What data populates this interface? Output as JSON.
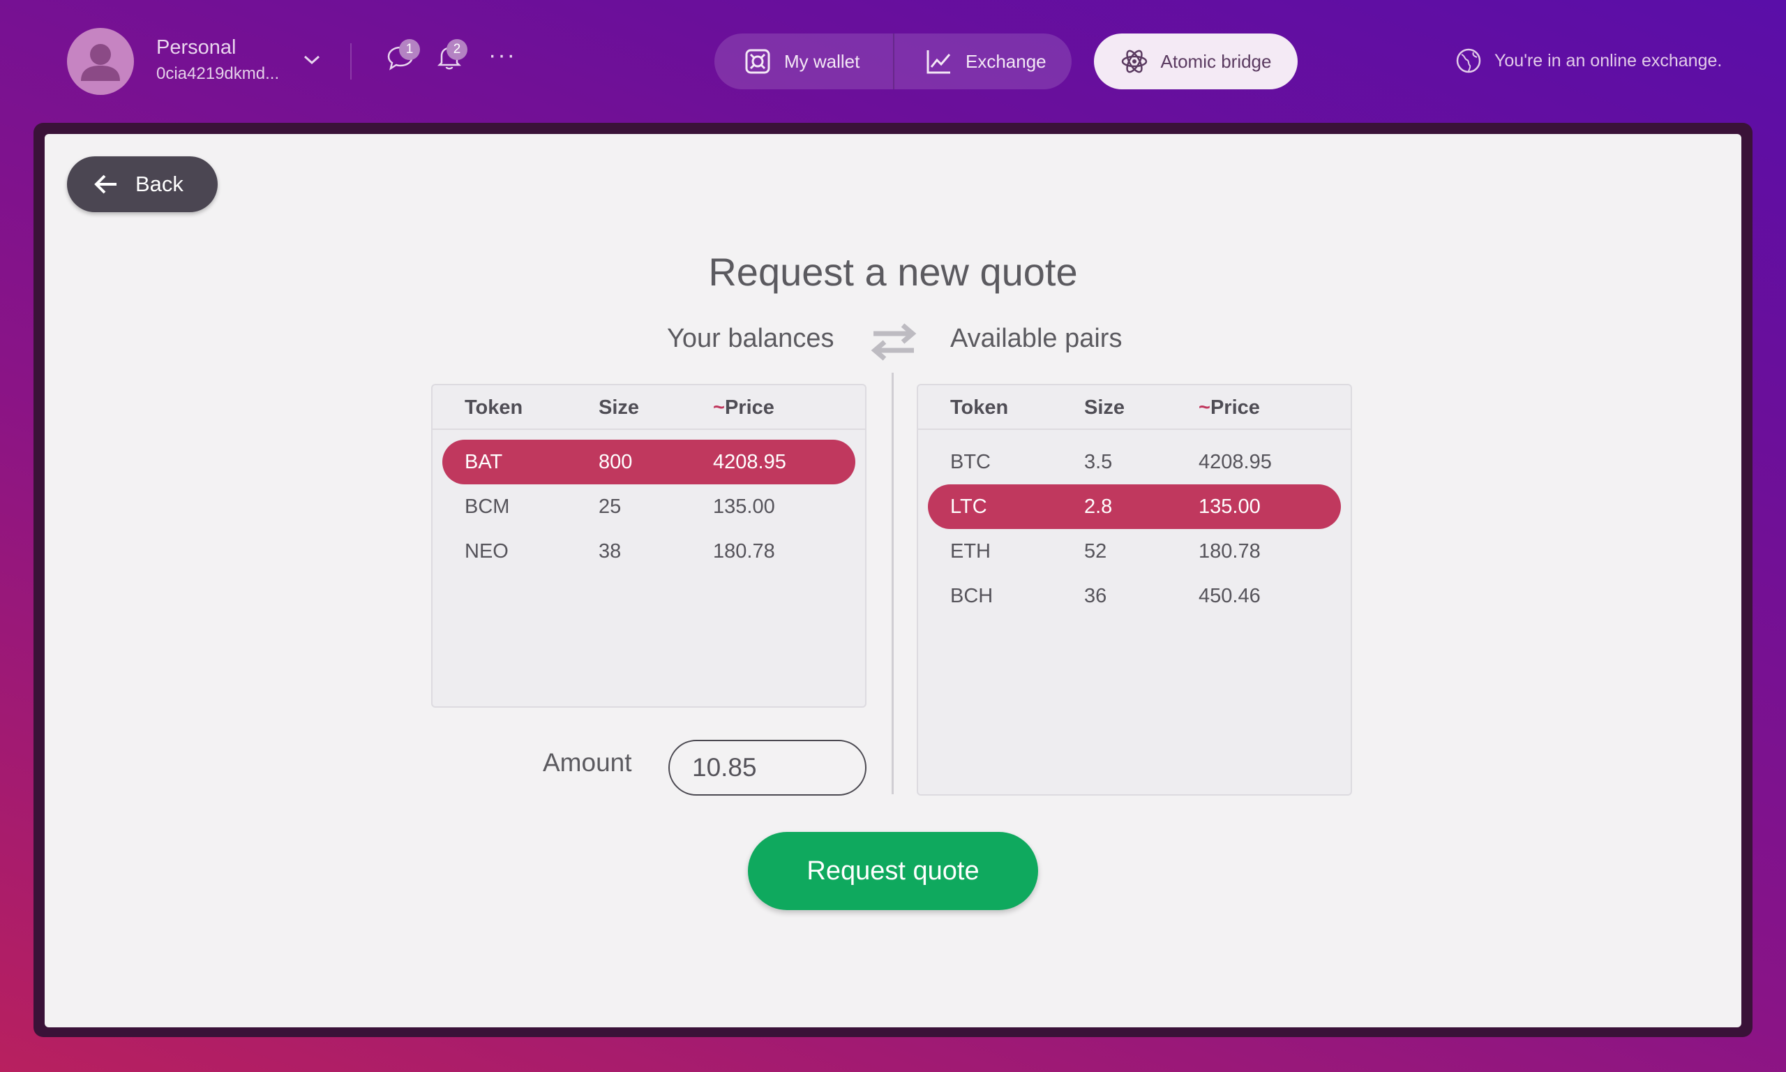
{
  "account": {
    "name": "Personal",
    "id": "0cia4219dkmd..."
  },
  "notifications": {
    "messages_count": "1",
    "alerts_count": "2"
  },
  "nav": {
    "wallet_label": "My wallet",
    "exchange_label": "Exchange",
    "bridge_label": "Atomic bridge"
  },
  "status_note": "You're in an online exchange.",
  "back_label": "Back",
  "title": "Request a new quote",
  "balances": {
    "heading": "Your balances",
    "columns": {
      "token": "Token",
      "size": "Size",
      "price_tilde": "~",
      "price": "Price"
    },
    "rows": [
      {
        "token": "BAT",
        "size": "800",
        "price": "4208.95",
        "selected": true
      },
      {
        "token": "BCM",
        "size": "25",
        "price": "135.00",
        "selected": false
      },
      {
        "token": "NEO",
        "size": "38",
        "price": "180.78",
        "selected": false
      }
    ]
  },
  "pairs": {
    "heading": "Available pairs",
    "columns": {
      "token": "Token",
      "size": "Size",
      "price_tilde": "~",
      "price": "Price"
    },
    "rows": [
      {
        "token": "BTC",
        "size": "3.5",
        "price": "4208.95",
        "selected": false
      },
      {
        "token": "LTC",
        "size": "2.8",
        "price": "135.00",
        "selected": true
      },
      {
        "token": "ETH",
        "size": "52",
        "price": "180.78",
        "selected": false
      },
      {
        "token": "BCH",
        "size": "36",
        "price": "450.46",
        "selected": false
      }
    ]
  },
  "amount": {
    "label": "Amount",
    "value": "10.85"
  },
  "request_button_label": "Request quote",
  "icons": [
    "user-avatar-icon",
    "chevron-down-icon",
    "chat-bubble-icon",
    "bell-icon",
    "more-icon",
    "wallet-icon",
    "chart-line-icon",
    "atom-icon",
    "globe-icon",
    "arrow-left-icon",
    "swap-arrows-icon"
  ],
  "colors": {
    "selected_row": "#c0385e",
    "primary_button": "#0fa95e",
    "back_button": "#4b4652",
    "price_tilde": "#c0385e"
  }
}
